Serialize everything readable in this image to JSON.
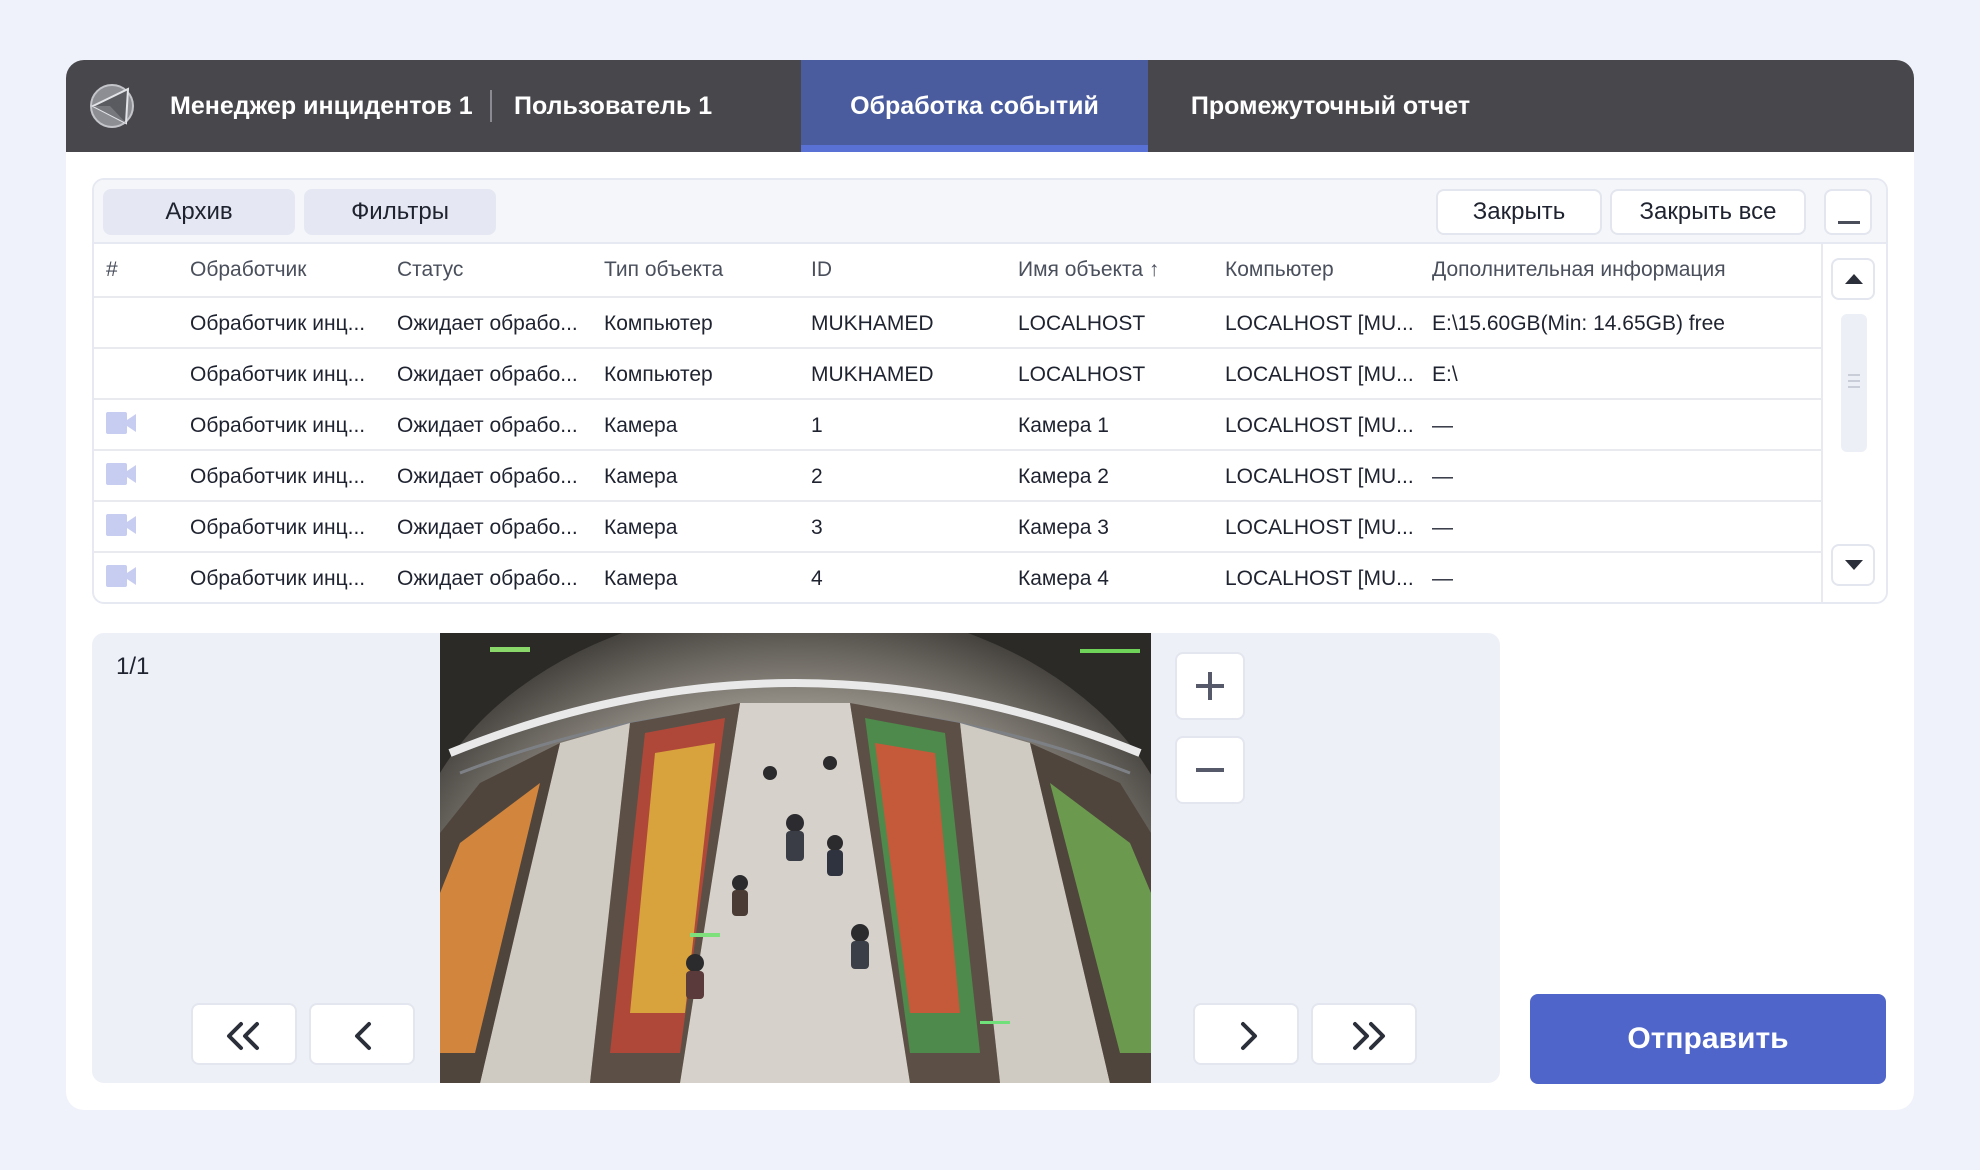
{
  "header": {
    "app_title": "Менеджер инцидентов 1",
    "user": "Пользователь 1",
    "tabs": [
      {
        "label": "Обработка событий",
        "active": true
      },
      {
        "label": "Промежуточный отчет",
        "active": false
      }
    ]
  },
  "toolbar": {
    "archive_label": "Архив",
    "filters_label": "Фильтры",
    "close_label": "Закрыть",
    "close_all_label": "Закрыть все"
  },
  "table": {
    "columns": [
      "#",
      "Обработчик",
      "Статус",
      "Тип объекта",
      "ID",
      "Имя объекта ↑",
      "Компьютер",
      "Дополнительная информация"
    ],
    "rows": [
      {
        "icon": "",
        "handler": "Обработчик инц...",
        "status": "Ожидает обрабо...",
        "type": "Компьютер",
        "id": "MUKHAMED",
        "name": "LOCALHOST",
        "computer": "LOCALHOST [MU...",
        "info": "E:\\15.60GB(Min: 14.65GB) free"
      },
      {
        "icon": "",
        "handler": "Обработчик инц...",
        "status": "Ожидает обрабо...",
        "type": "Компьютер",
        "id": "MUKHAMED",
        "name": "LOCALHOST",
        "computer": "LOCALHOST [MU...",
        "info": "E:\\"
      },
      {
        "icon": "camera-icon",
        "handler": "Обработчик инц...",
        "status": "Ожидает обрабо...",
        "type": "Камера",
        "id": "1",
        "name": "Камера 1",
        "computer": "LOCALHOST [MU...",
        "info": "—"
      },
      {
        "icon": "camera-icon",
        "handler": "Обработчик инц...",
        "status": "Ожидает обрабо...",
        "type": "Камера",
        "id": "2",
        "name": "Камера 2",
        "computer": "LOCALHOST [MU...",
        "info": "—"
      },
      {
        "icon": "camera-icon",
        "handler": "Обработчик инц...",
        "status": "Ожидает обрабо...",
        "type": "Камера",
        "id": "3",
        "name": "Камера 3",
        "computer": "LOCALHOST [MU...",
        "info": "—"
      },
      {
        "icon": "camera-icon",
        "handler": "Обработчик инц...",
        "status": "Ожидает обрабо...",
        "type": "Камера",
        "id": "4",
        "name": "Камера 4",
        "computer": "LOCALHOST [MU...",
        "info": "—"
      }
    ]
  },
  "viewer": {
    "page_counter": "1/1"
  },
  "send_label": "Отправить",
  "colors": {
    "header_bg": "#47474c",
    "active_tab": "#4b5c9e",
    "active_tab_underline": "#5971d5",
    "accent": "#4f65c9",
    "camera_icon": "#c7cdf0"
  }
}
